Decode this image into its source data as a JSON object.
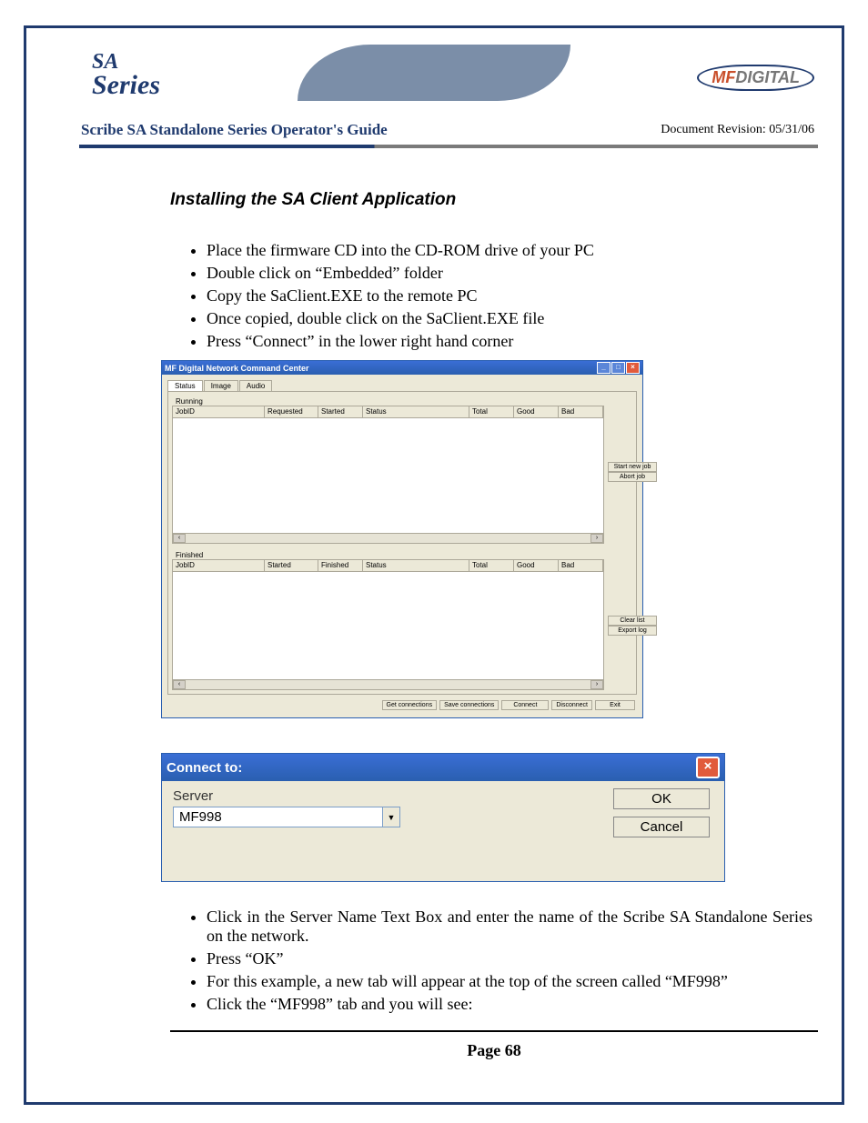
{
  "header": {
    "logo_left_line1": "SA",
    "logo_left_line2": "Series",
    "logo_right_mf": "MF",
    "logo_right_rest": "DIGITAL",
    "title": "Scribe SA Standalone Series Operator's Guide",
    "revision": "Document Revision: 05/31/06"
  },
  "section_title": "Installing the SA Client Application",
  "bullets_top": [
    "Place the firmware CD into the CD-ROM drive of your PC",
    "Double click on “Embedded” folder",
    "Copy the SaClient.EXE to the remote PC",
    "Once copied, double click on the SaClient.EXE file",
    "Press “Connect” in the lower right hand corner"
  ],
  "win1": {
    "title": "MF Digital Network Command Center",
    "tabs": [
      "Status",
      "Image",
      "Audio"
    ],
    "running_label": "Running",
    "running_cols": [
      "JobID",
      "Requested",
      "Started",
      "Status",
      "Total",
      "Good",
      "Bad"
    ],
    "running_btns": [
      "Start new job",
      "Abort job"
    ],
    "finished_label": "Finished",
    "finished_cols": [
      "JobID",
      "Started",
      "Finished",
      "Status",
      "Total",
      "Good",
      "Bad"
    ],
    "finished_btns": [
      "Clear list",
      "Export log"
    ],
    "bottom_btns": [
      "Get connections",
      "Save connections",
      "Connect",
      "Disconnect",
      "Exit"
    ]
  },
  "win2": {
    "title": "Connect to:",
    "server_label": "Server",
    "server_value": "MF998",
    "ok": "OK",
    "cancel": "Cancel"
  },
  "bullets_bottom": [
    "Click in the Server Name Text Box and enter the name of the Scribe SA Standalone Series on the network.",
    "Press “OK”",
    "For this example, a new tab will appear at the top of the screen called “MF998”",
    "Click the “MF998” tab and you will see:"
  ],
  "page_number": "Page 68"
}
